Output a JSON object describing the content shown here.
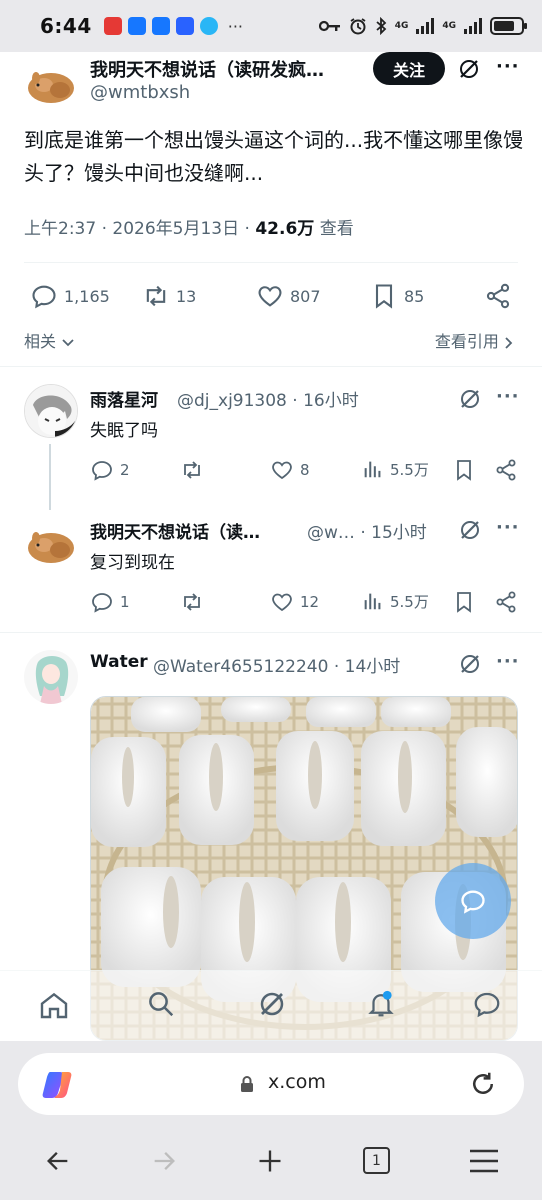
{
  "status_bar": {
    "time": "6:44",
    "network": "4G",
    "battery_level": 0.75
  },
  "main_tweet": {
    "author_name": "我明天不想说话（读研发疯…",
    "author_handle": "@wmtbxsh",
    "follow_label": "关注",
    "text": "到底是谁第一个想出馒头逼这个词的...我不懂这哪里像馒头了？馒头中间也没缝啊...",
    "time": "上午2:37",
    "date": "2026年5月13日",
    "views_count": "42.6万",
    "views_label": "查看",
    "replies": "1,165",
    "retweets": "13",
    "likes": "807",
    "bookmarks": "85",
    "related_label": "相关",
    "view_quotes_label": "查看引用"
  },
  "replies": [
    {
      "name": "雨落星河",
      "handle": "@dj_xj91308",
      "time": "16小时",
      "text": "失眠了吗",
      "replies": "2",
      "retweets": "",
      "likes": "8",
      "views": "5.5万"
    },
    {
      "name": "我明天不想说话（读…",
      "handle": "@w…",
      "time": "15小时",
      "text": "复习到现在",
      "replies": "1",
      "retweets": "",
      "likes": "12",
      "views": "5.5万"
    },
    {
      "name": "Water",
      "handle": "@Water4655122240",
      "time": "14小时"
    }
  ],
  "browser": {
    "url": "x.com",
    "tab_count": "1"
  },
  "colors": {
    "accent": "#1d9bf0",
    "text_primary": "#0f1419",
    "text_secondary": "#536471",
    "chrome_bg": "#e9e9ec"
  },
  "icons": {
    "reply": "reply-icon",
    "retweet": "retweet-icon",
    "like": "heart-icon",
    "bookmark": "bookmark-icon",
    "share": "share-icon",
    "views": "views-icon",
    "grok": "grok-icon",
    "more": "more-icon"
  }
}
